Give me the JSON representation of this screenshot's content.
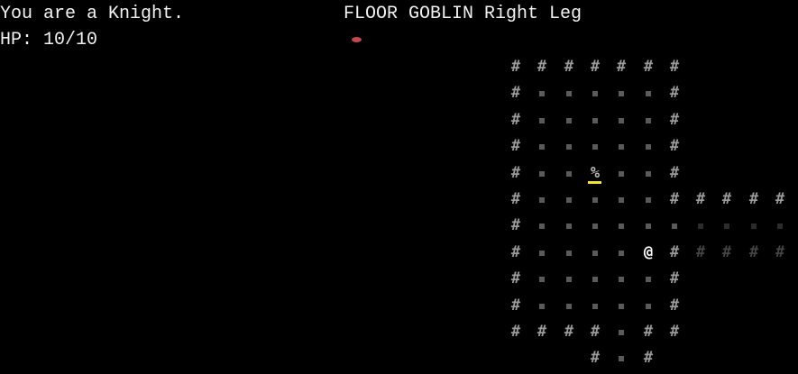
{
  "status": {
    "class_line": "You are a Knight.",
    "hp_line": "HP: 10/10"
  },
  "look": {
    "text": "FLOOR GOBLIN Right Leg",
    "icon": "goblin-leg-icon",
    "icon_color": "#c0484e"
  },
  "colors": {
    "background": "#000000",
    "wall": "#9a9a9a",
    "wall_dim": "#444444",
    "floor": "#5a5a5a",
    "floor_dim": "#2c2c2c",
    "player": "#ffffff",
    "item": "#b8b8b8",
    "item_highlight": "#f2e233"
  },
  "map": {
    "legend": {
      "#": "wall",
      ".": "floor",
      "@": "player",
      "%": "item"
    },
    "rows": [
      "#######    ",
      "#.....#    ",
      "#.....#    ",
      "#.....#    ",
      "#..%..#    ",
      "#.....#####",
      "#..........",
      "#....@#####",
      "#.....#    ",
      "#.....#    ",
      "####.##    ",
      "   #.#     "
    ],
    "dim_cells": [
      [
        6,
        7
      ],
      [
        6,
        8
      ],
      [
        6,
        9
      ],
      [
        6,
        10
      ],
      [
        7,
        7
      ],
      [
        7,
        8
      ],
      [
        7,
        9
      ],
      [
        7,
        10
      ]
    ],
    "highlighted_item": [
      4,
      3
    ]
  }
}
